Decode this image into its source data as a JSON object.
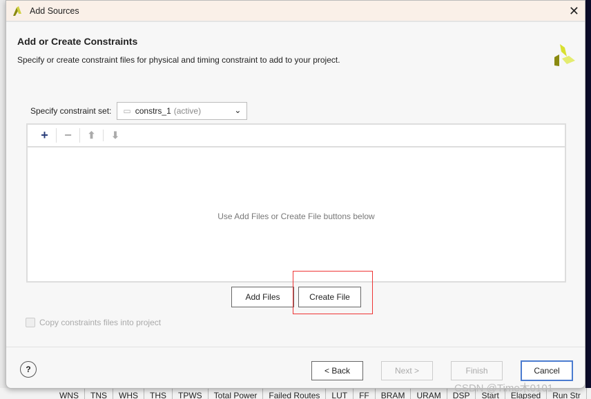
{
  "dialog": {
    "title": "Add Sources",
    "heading": "Add or Create Constraints",
    "description": "Specify or create constraint files for physical and timing constraint to add to your project."
  },
  "constraint_set": {
    "label": "Specify constraint set:",
    "value": "constrs_1",
    "suffix": "(active)"
  },
  "toolbar": {
    "add": "+",
    "remove": "−",
    "up": "⬆",
    "down": "⬇"
  },
  "panel": {
    "empty_text": "Use Add Files or Create File buttons below"
  },
  "buttons": {
    "add_files": "Add Files",
    "create_file": "Create File",
    "back": "< Back",
    "next": "Next >",
    "finish": "Finish",
    "cancel": "Cancel",
    "help": "?"
  },
  "copy_checkbox": {
    "label": "Copy constraints files into project",
    "checked": false
  },
  "background_columns": [
    "WNS",
    "TNS",
    "WHS",
    "THS",
    "TPWS",
    "Total Power",
    "Failed Routes",
    "LUT",
    "FF",
    "BRAM",
    "URAM",
    "DSP",
    "Start",
    "Elapsed",
    "Run Str"
  ],
  "watermark": "CSDN @Time木0101",
  "colors": {
    "accent": "#4a7bd0",
    "highlight": "#e33333",
    "logo": "#c8d020"
  }
}
